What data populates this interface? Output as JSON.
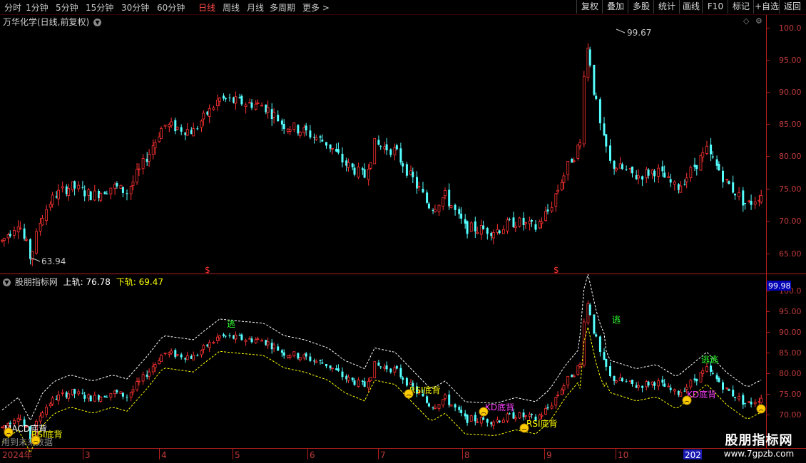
{
  "toolbar": {
    "periods": [
      "分时",
      "1分钟",
      "5分钟",
      "15分钟",
      "30分钟",
      "60分钟",
      "日线",
      "周线",
      "月线",
      "多周期",
      "更多 >"
    ],
    "active_period": "日线",
    "buttons": [
      "复权",
      "叠加",
      "多股",
      "统计",
      "画线",
      "F10",
      "标记",
      "+自选",
      "返回"
    ]
  },
  "main_panel": {
    "title": "万华化学(日线,前复权)",
    "high_label": "99.67",
    "low_label": "63.94",
    "y_ticks": [
      "100.0",
      "95.00",
      "90.00",
      "85.00",
      "80.00",
      "75.00",
      "70.00",
      "65.00"
    ],
    "markers": [
      "$",
      "$"
    ]
  },
  "indicator_panel": {
    "name": "股朋指标网",
    "upper_label": "上轨:",
    "upper_value": "76.78",
    "lower_label": "下轨:",
    "lower_value": "69.47",
    "current_value": "99.98",
    "y_ticks": [
      "100.0",
      "95.00",
      "90.00",
      "85.00",
      "80.00",
      "75.00",
      "70.00"
    ],
    "annotations": {
      "escape": "逃",
      "escape_double": "逃逃",
      "macd_div": "MACD底背",
      "rsi_div": "RSI底背",
      "kd_div": "KD底背",
      "note": "用到未来数据"
    }
  },
  "x_axis": {
    "labels": [
      "2024年",
      "3",
      "4",
      "5",
      "6",
      "7",
      "8",
      "9",
      "10",
      "202"
    ]
  },
  "watermark": {
    "title": "股朋指标网",
    "url": "www.7gpzb.com"
  },
  "colors": {
    "up": "#ff3232",
    "down": "#54ffff",
    "axis": "#b31e1e",
    "active": "#ff4a4a",
    "upper_band": "#ffffff",
    "lower_band": "#ffff00"
  }
}
